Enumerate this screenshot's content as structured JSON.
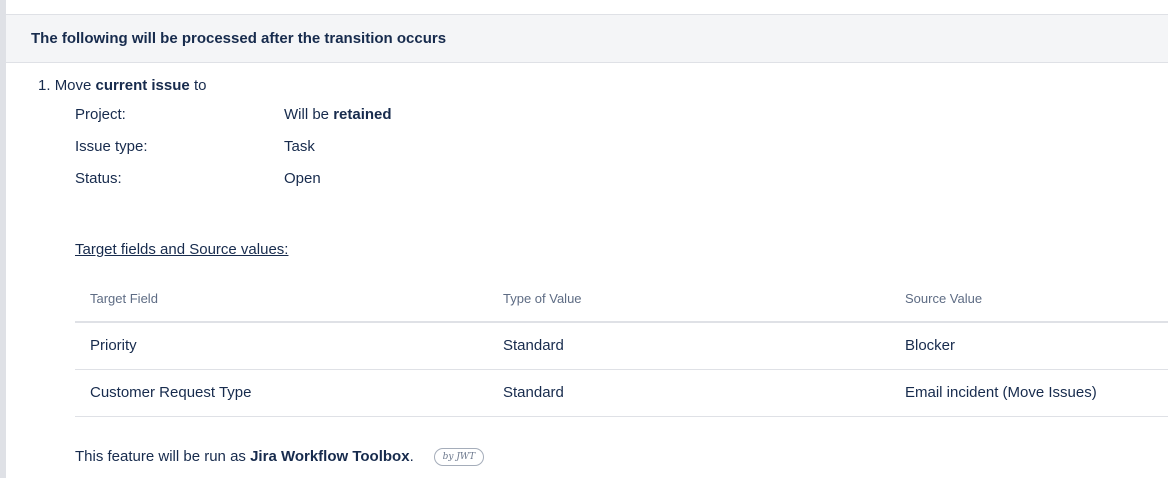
{
  "header": {
    "title": "The following will be processed after the transition occurs"
  },
  "step": {
    "number": "1.",
    "text_before": "Move",
    "bold": "current issue",
    "text_after": "to"
  },
  "properties": [
    {
      "label": "Project:",
      "value_prefix": "Will be",
      "value_bold": "retained"
    },
    {
      "label": "Issue type:",
      "value_prefix": "Task",
      "value_bold": ""
    },
    {
      "label": "Status:",
      "value_prefix": "Open",
      "value_bold": ""
    }
  ],
  "section_title": "Target fields and Source values:",
  "table": {
    "columns": [
      "Target Field",
      "Type of Value",
      "Source Value"
    ],
    "rows": [
      [
        "Priority",
        "Standard",
        "Blocker"
      ],
      [
        "Customer Request Type",
        "Standard",
        "Email incident (Move Issues)"
      ]
    ]
  },
  "footer": {
    "text_before": "This feature will be run as",
    "bold": "Jira Workflow Toolbox",
    "text_after": ".",
    "badge": "by JWT"
  }
}
